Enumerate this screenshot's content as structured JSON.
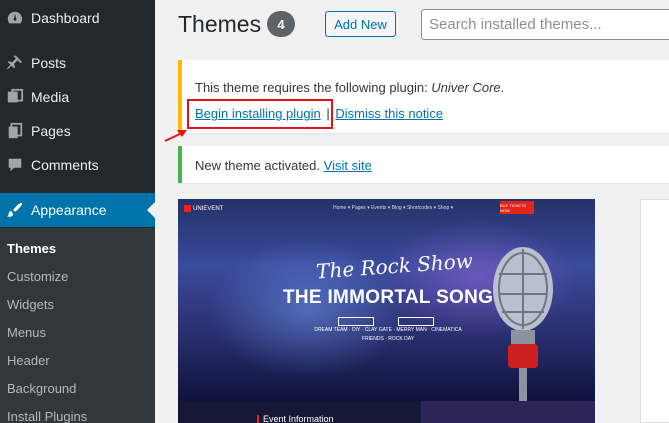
{
  "sidebar": {
    "items": [
      {
        "label": "Dashboard",
        "icon": "dashboard-icon"
      },
      {
        "label": "Posts",
        "icon": "pin-icon"
      },
      {
        "label": "Media",
        "icon": "media-icon"
      },
      {
        "label": "Pages",
        "icon": "pages-icon"
      },
      {
        "label": "Comments",
        "icon": "comment-icon"
      },
      {
        "label": "Appearance",
        "icon": "paintbrush-icon"
      }
    ],
    "submenu": [
      "Themes",
      "Customize",
      "Widgets",
      "Menus",
      "Header",
      "Background",
      "Install Plugins"
    ]
  },
  "header": {
    "title": "Themes",
    "count": "4",
    "add_new": "Add New",
    "search_placeholder": "Search installed themes..."
  },
  "notices": {
    "plugin_text_prefix": "This theme requires the following plugin: ",
    "plugin_name": "Univer Core",
    "plugin_text_suffix": ".",
    "begin_link": "Begin installing plugin",
    "separator": "|",
    "dismiss_link": "Dismiss this notice",
    "activated_text": "New theme activated.",
    "visit_link": "Visit site"
  },
  "theme_preview": {
    "logo": "UNIEVENT",
    "nav": "Home ▾   Pages ▾   Events ▾   Blog ▾   Shortcodes ▾   Shop ▾",
    "button": "BUY TICKETS NOW",
    "script_title": "The Rock Show",
    "main_title": "THE IMMORTAL SONGS",
    "meta_line1": "DREAM TEAM · DIY · CLAY GATE · MERRY MAN · CINEMATICA",
    "meta_line2": "FRIENDS · ROCK DAY",
    "event_label": "Event Information"
  },
  "colors": {
    "sidebar_bg": "#23282d",
    "accent": "#0073aa",
    "warning": "#ffb900",
    "success": "#46b450",
    "highlight": "#e8111b"
  }
}
